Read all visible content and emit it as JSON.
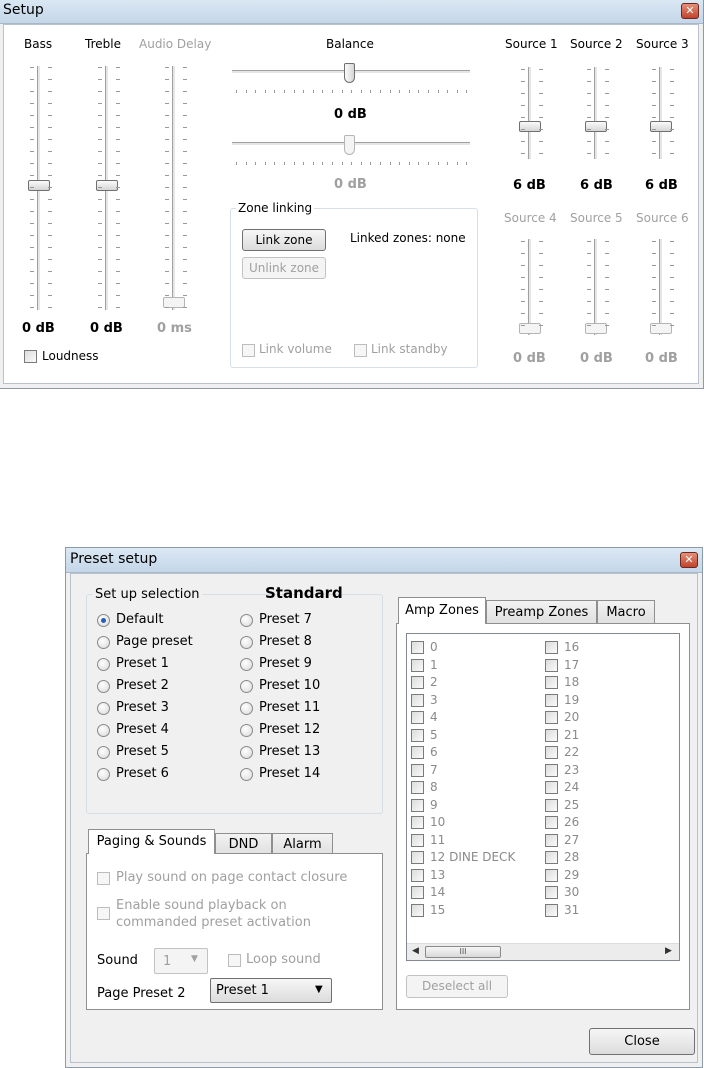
{
  "setup": {
    "title": "Setup",
    "tone_labels": {
      "bass": "Bass",
      "treble": "Treble",
      "audio_delay": "Audio Delay"
    },
    "tone_values": {
      "bass": "0 dB",
      "treble": "0 dB",
      "audio_delay": "0 ms"
    },
    "loudness_label": "Loudness",
    "balance": {
      "label": "Balance",
      "value1": "0 dB",
      "value2": "0 dB"
    },
    "zone_linking": {
      "legend": "Zone linking",
      "link_button": "Link zone",
      "unlink_button": "Unlink zone",
      "linked_text": "Linked zones: none",
      "link_volume": "Link volume",
      "link_standby": "Link standby"
    },
    "sources": [
      {
        "label": "Source 1",
        "value": "6 dB"
      },
      {
        "label": "Source 2",
        "value": "6 dB"
      },
      {
        "label": "Source 3",
        "value": "6 dB"
      },
      {
        "label": "Source 4",
        "value": "0 dB"
      },
      {
        "label": "Source 5",
        "value": "0 dB"
      },
      {
        "label": "Source 6",
        "value": "0 dB"
      }
    ]
  },
  "preset": {
    "title": "Preset setup",
    "group_legend": "Set up selection",
    "current_name": "Standard",
    "options": [
      "Default",
      "Page preset",
      "Preset 1",
      "Preset 2",
      "Preset 3",
      "Preset 4",
      "Preset 5",
      "Preset 6",
      "Preset 7",
      "Preset 8",
      "Preset 9",
      "Preset 10",
      "Preset 11",
      "Preset 12",
      "Preset 13",
      "Preset 14"
    ],
    "selected_option": "Default",
    "tabs": [
      "Paging & Sounds",
      "DND",
      "Alarm"
    ],
    "paging": {
      "play_sound": "Play sound on page contact closure",
      "enable_playback_1": "Enable sound playback on",
      "enable_playback_2": "commanded preset activation",
      "sound_label": "Sound",
      "sound_value": "1",
      "loop_label": "Loop sound",
      "page_preset_label": "Page Preset 2",
      "page_preset_value": "Preset 1"
    },
    "zone_tabs": [
      "Amp Zones",
      "Preamp Zones",
      "Macro"
    ],
    "zones": [
      "0",
      "1",
      "2",
      "3",
      "4",
      "5",
      "6",
      "7",
      "8",
      "9",
      "10",
      "11",
      "12 DINE DECK",
      "13",
      "14",
      "15",
      "16",
      "17",
      "18",
      "19",
      "20",
      "21",
      "22",
      "23",
      "24",
      "25",
      "26",
      "27",
      "28",
      "29",
      "30",
      "31"
    ],
    "scroll_thumb_glyph": "III",
    "deselect_button": "Deselect all",
    "close_button": "Close"
  }
}
